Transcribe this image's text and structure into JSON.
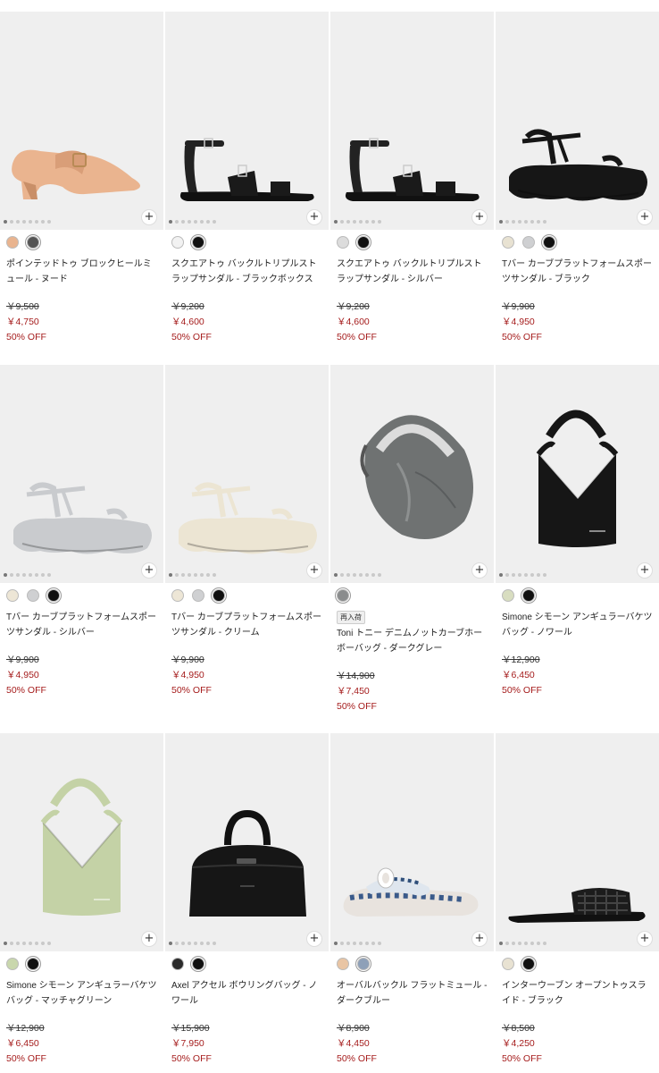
{
  "products": [
    {
      "name": "ポインテッドトゥ ブロックヒールミュール - ヌード",
      "original": "￥9,500",
      "sale": "￥4,750",
      "discount": "50% OFF",
      "badge": "",
      "icon": "block-heel-mule-icon",
      "colors": [
        "#e9b48f",
        "#555555"
      ]
    },
    {
      "name": "スクエアトゥ バックルトリプルストラップサンダル - ブラックボックス",
      "original": "￥9,200",
      "sale": "￥4,600",
      "discount": "50% OFF",
      "badge": "",
      "icon": "strap-sandal-icon",
      "colors": [
        "#f2f2f2",
        "#111111"
      ]
    },
    {
      "name": "スクエアトゥ バックルトリプルストラップサンダル - シルバー",
      "original": "￥9,200",
      "sale": "￥4,600",
      "discount": "50% OFF",
      "badge": "",
      "icon": "strap-sandal-icon",
      "colors": [
        "#dcdcdc",
        "#111111"
      ]
    },
    {
      "name": "Tバー カーブプラットフォームスポーツサンダル - ブラック",
      "original": "￥9,900",
      "sale": "￥4,950",
      "discount": "50% OFF",
      "badge": "",
      "icon": "platform-sandal-icon",
      "colors": [
        "#e8e2d2",
        "#cfd0d2",
        "#111111"
      ]
    },
    {
      "name": "Tバー カーブプラットフォームスポーツサンダル - シルバー",
      "original": "￥9,900",
      "sale": "￥4,950",
      "discount": "50% OFF",
      "badge": "",
      "icon": "platform-sandal-icon",
      "colors": [
        "#ede6d6",
        "#cfd0d2",
        "#111111"
      ]
    },
    {
      "name": "Tバー カーブプラットフォームスポーツサンダル - クリーム",
      "original": "￥9,900",
      "sale": "￥4,950",
      "discount": "50% OFF",
      "badge": "",
      "icon": "platform-sandal-icon",
      "colors": [
        "#ede6d6",
        "#cfd0d2",
        "#111111"
      ]
    },
    {
      "name": "Toni トニー デニムノットカーブホーボーバッグ - ダークグレー",
      "original": "￥14,900",
      "sale": "￥7,450",
      "discount": "50% OFF",
      "badge": "再入荷",
      "icon": "hobo-bag-icon",
      "colors": [
        "#8a8c8d"
      ]
    },
    {
      "name": "Simone シモーン アンギュラーバケツバッグ - ノワール",
      "original": "￥12,900",
      "sale": "￥6,450",
      "discount": "50% OFF",
      "badge": "",
      "icon": "bucket-bag-icon",
      "colors": [
        "#d8ddc0",
        "#111111"
      ]
    },
    {
      "name": "Simone シモーン アンギュラーバケツバッグ - マッチャグリーン",
      "original": "￥12,900",
      "sale": "￥6,450",
      "discount": "50% OFF",
      "badge": "",
      "icon": "bucket-bag-icon",
      "colors": [
        "#c9d7ad",
        "#111111"
      ]
    },
    {
      "name": "Axel アクセル ボウリングバッグ - ノワール",
      "original": "￥15,900",
      "sale": "￥7,950",
      "discount": "50% OFF",
      "badge": "",
      "icon": "bowling-bag-icon",
      "colors": [
        "#2b2b2b",
        "#111111"
      ]
    },
    {
      "name": "オーバルバックル フラットミュール - ダークブルー",
      "original": "￥8,900",
      "sale": "￥4,450",
      "discount": "50% OFF",
      "badge": "",
      "icon": "flat-mule-icon",
      "colors": [
        "#e9c5a4",
        "#8ea0b8"
      ]
    },
    {
      "name": "インターウーブン オープントゥスライド - ブラック",
      "original": "￥8,500",
      "sale": "￥4,250",
      "discount": "50% OFF",
      "badge": "",
      "icon": "woven-slide-icon",
      "colors": [
        "#e8e2d2",
        "#111111"
      ]
    }
  ]
}
